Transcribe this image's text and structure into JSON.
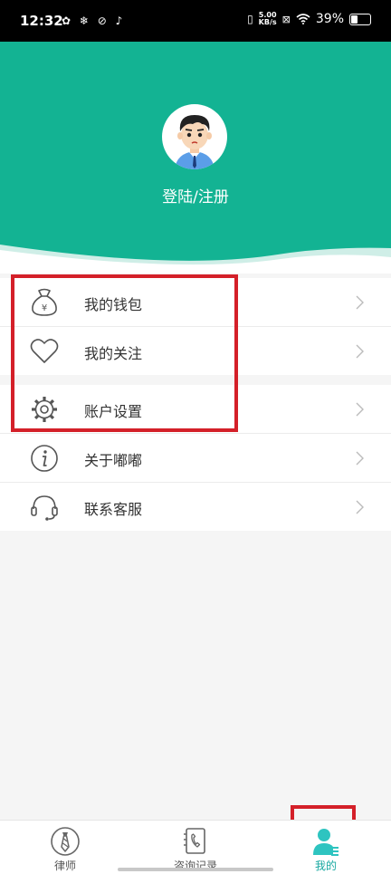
{
  "status_bar": {
    "time": "12:32",
    "net_speed_value": "5.00",
    "net_speed_unit": "KB/s",
    "battery": "39%",
    "battery_level": 0.39
  },
  "header": {
    "login_label": "登陆/注册",
    "brand_color": "#13b393"
  },
  "menu": {
    "group1": [
      {
        "label": "我的钱包",
        "icon": "money-bag-icon"
      },
      {
        "label": "我的关注",
        "icon": "heart-icon"
      }
    ],
    "group2": [
      {
        "label": "账户设置",
        "icon": "gear-icon"
      },
      {
        "label": "关于嘟嘟",
        "icon": "info-icon"
      },
      {
        "label": "联系客服",
        "icon": "headset-icon"
      }
    ]
  },
  "tabbar": {
    "tabs": [
      {
        "label": "律师",
        "icon": "lawyer-tie-icon"
      },
      {
        "label": "咨询记录",
        "icon": "phone-record-icon"
      },
      {
        "label": "我的",
        "icon": "user-profile-icon",
        "active": true
      }
    ],
    "active_color": "#17a8a0"
  },
  "highlight_color": "#d42029"
}
